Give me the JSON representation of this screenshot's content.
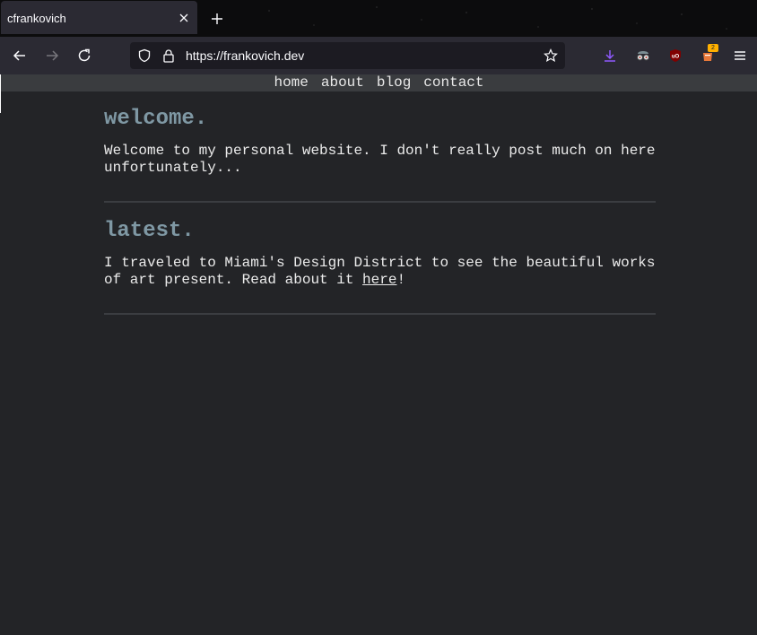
{
  "browser": {
    "tab_title": "cfrankovich",
    "url": "https://frankovich.dev",
    "extension_badge": "2",
    "icons": {
      "tab_close": "close-icon",
      "new_tab": "plus-icon",
      "back": "back-arrow-icon",
      "forward": "forward-arrow-icon",
      "reload": "reload-icon",
      "shield": "tracking-shield-icon",
      "lock": "lock-icon",
      "bookmark": "star-icon",
      "downloads": "download-icon",
      "ext1": "privacy-glasses-icon",
      "ext2": "ublock-origin-icon",
      "ext3": "bucket-extension-icon",
      "menu": "hamburger-menu-icon"
    },
    "colors": {
      "download_accent": "#9059ff",
      "ublock_red": "#800000",
      "badge": "#ffb000"
    }
  },
  "site": {
    "nav": [
      "home",
      "about",
      "blog",
      "contact"
    ],
    "sections": [
      {
        "heading": "welcome.",
        "body": "Welcome to my personal website. I don't really post much on here unfortunately..."
      },
      {
        "heading": "latest.",
        "body_before": "I traveled to Miami's Design District to see the beautiful works of art present. Read about it ",
        "link_text": "here",
        "body_after": "!"
      }
    ],
    "colors": {
      "background": "#232427",
      "heading": "#7f98a4",
      "text": "#ececec"
    }
  }
}
